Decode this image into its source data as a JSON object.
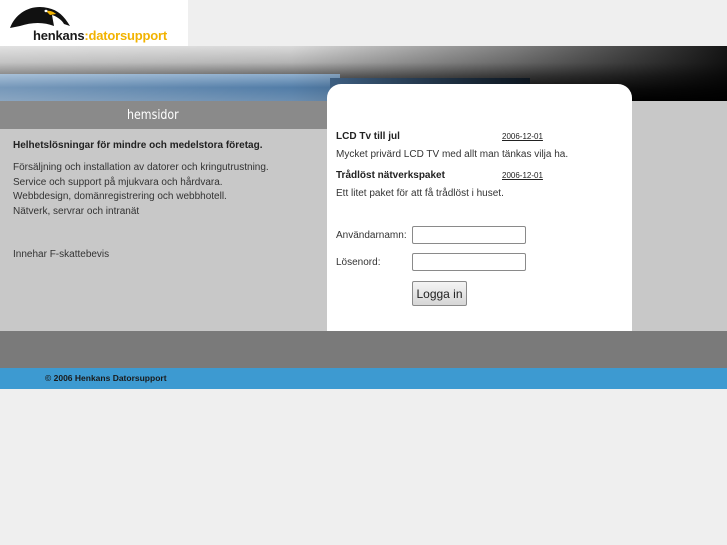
{
  "logo": {
    "part1": "henkans",
    "colon": ":",
    "part2": "datorsupport",
    "icon": "penguin-icon"
  },
  "nav": {
    "tab_label": "hemsidor"
  },
  "left": {
    "heading": "Helhetslösningar för mindre och medelstora företag.",
    "lines": [
      "Försäljning och installation av datorer och kringutrustning.",
      "Service och support på mjukvara och hårdvara.",
      "Webbdesign, domänregistrering och webbhotell.",
      "Nätverk, servrar och intranät"
    ],
    "note": "Innehar F-skattebevis"
  },
  "news": [
    {
      "title": "LCD Tv till jul",
      "date": "2006-12-01",
      "body": "Mycket privärd LCD TV med allt man tänkas vilja ha."
    },
    {
      "title": "Trådlöst nätverkspaket",
      "date": "2006-12-01",
      "body": "Ett litet paket för att få trådlöst i huset."
    }
  ],
  "login": {
    "username_label": "Användarnamn:",
    "password_label": "Lösenord:",
    "username_value": "",
    "password_value": "",
    "button_label": "Logga in"
  },
  "footer": {
    "copyright": "© 2006 Henkans Datorsupport"
  },
  "colors": {
    "footer_bar": "#3d9ad1",
    "logo_accent": "#f2b300"
  }
}
